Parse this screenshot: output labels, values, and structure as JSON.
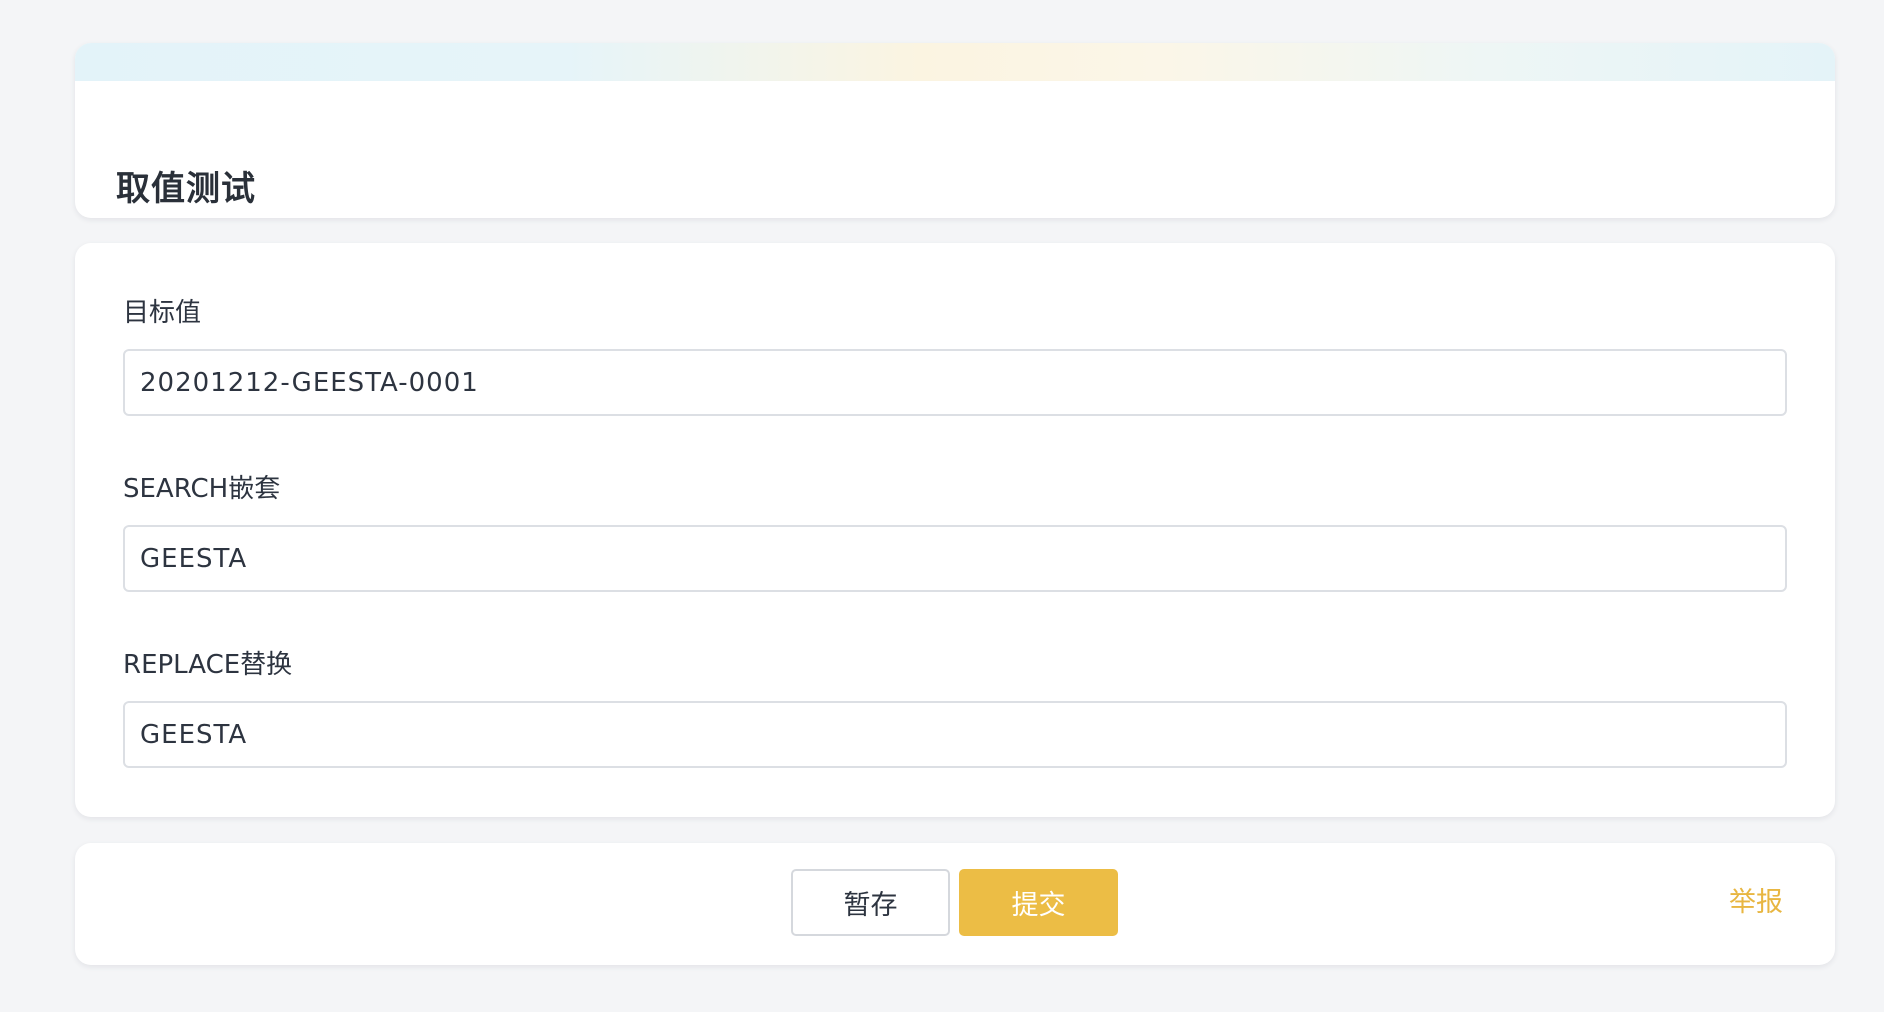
{
  "header": {
    "title": "取值测试"
  },
  "form": {
    "fields": [
      {
        "label": "目标值",
        "value": "20201212-GEESTA-0001"
      },
      {
        "label": "SEARCH嵌套",
        "value": "GEESTA"
      },
      {
        "label": "REPLACE替换",
        "value": "GEESTA"
      }
    ]
  },
  "footer": {
    "save_label": "暂存",
    "submit_label": "提交",
    "report_label": "举报"
  },
  "colors": {
    "page_background": "#f4f5f7",
    "accent": "#ecbd45",
    "report_link": "#e8b641",
    "text": "#2d3440",
    "input_border": "#dcdfe4"
  }
}
